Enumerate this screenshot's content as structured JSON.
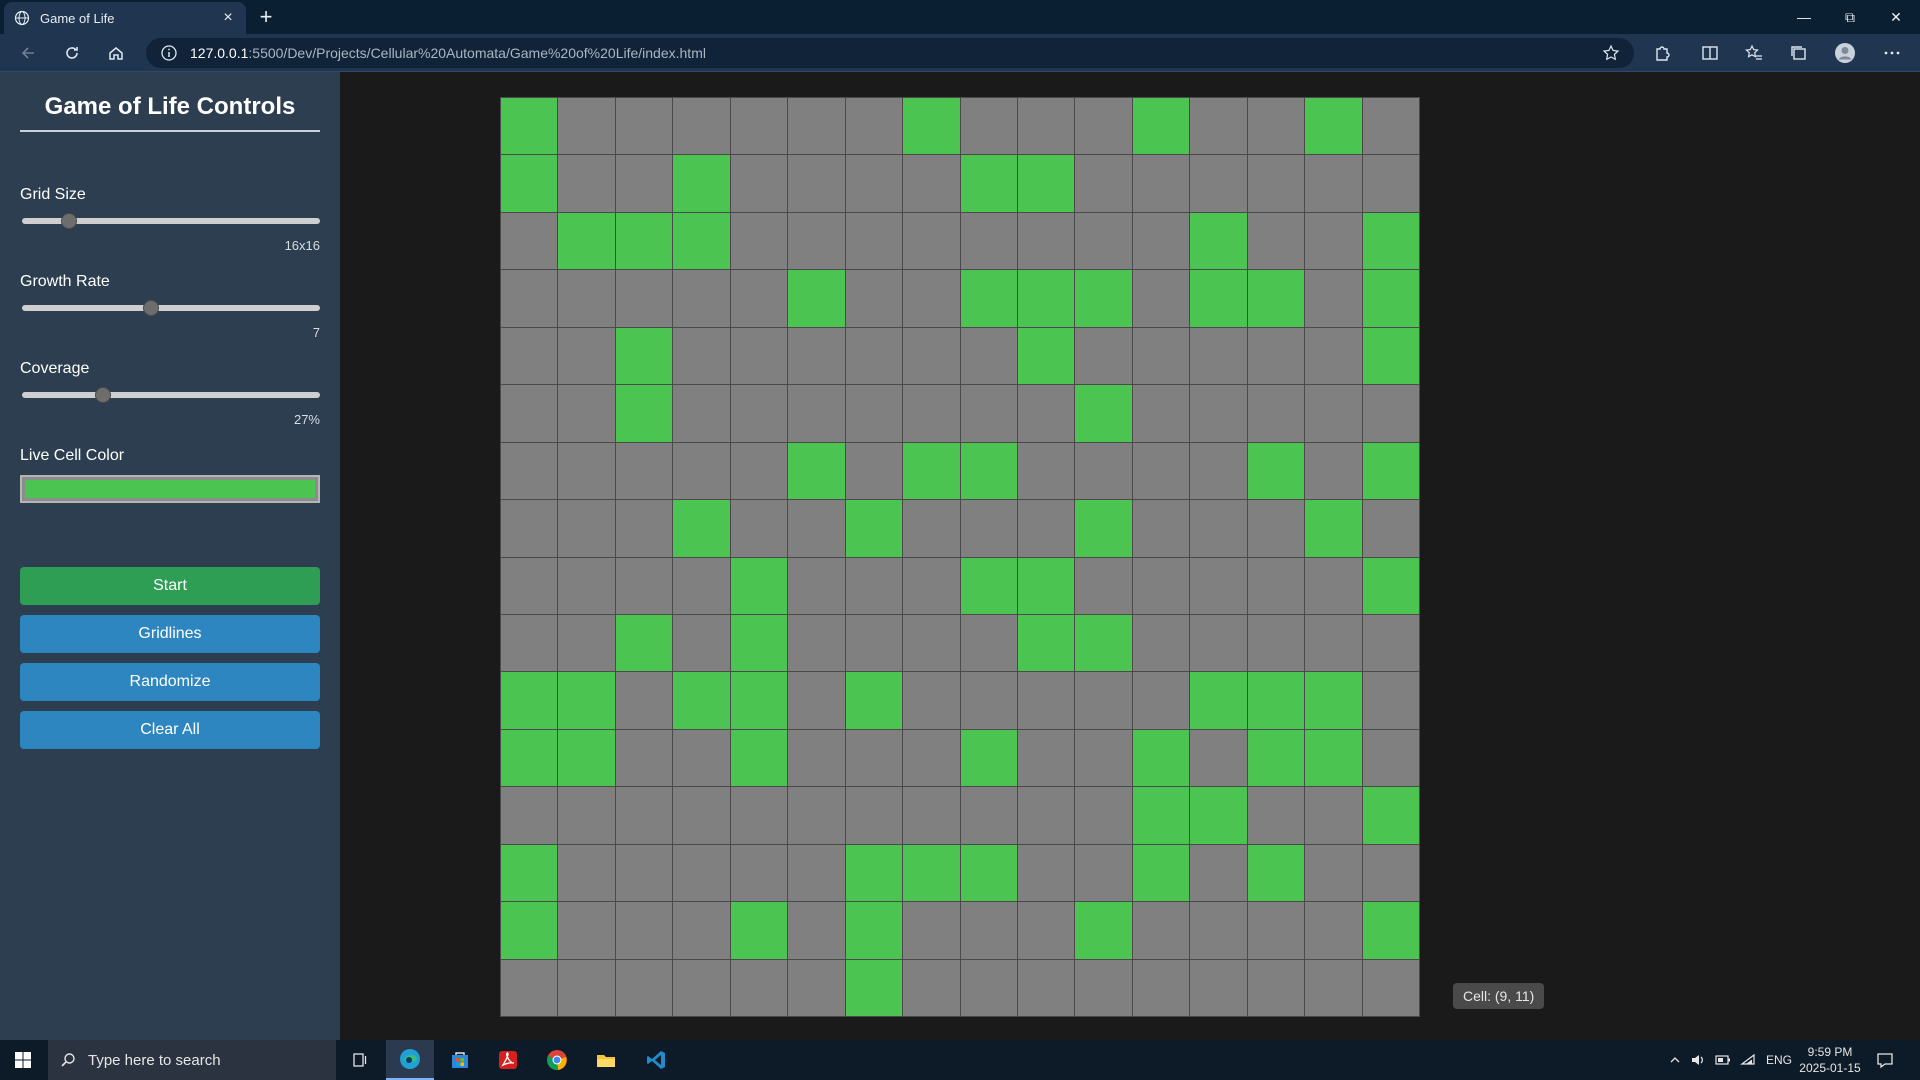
{
  "browser": {
    "tab_title": "Game of Life",
    "url_host": "127.0.0.1",
    "url_path": ":5500/Dev/Projects/Cellular%20Automata/Game%20of%20Life/index.html"
  },
  "sidebar": {
    "title": "Game of Life Controls",
    "grid_size": {
      "label": "Grid Size",
      "value_text": "16x16",
      "fraction": 0.14
    },
    "growth_rate": {
      "label": "Growth Rate",
      "value_text": "7",
      "fraction": 0.43
    },
    "coverage": {
      "label": "Coverage",
      "value_text": "27%",
      "fraction": 0.26
    },
    "live_cell_color": {
      "label": "Live Cell Color",
      "value": "#4cc452"
    },
    "buttons": {
      "start": "Start",
      "gridlines": "Gridlines",
      "randomize": "Randomize",
      "clear_all": "Clear All"
    }
  },
  "grid": {
    "size": 16,
    "alive_color": "#4cc452",
    "dead_color": "#808080",
    "rows": [
      "1000000100010010",
      "1001000011000000",
      "0111000000001001",
      "0000010011101101",
      "0010000001000001",
      "0010000000100000",
      "0000010110000101",
      "0001001000100010",
      "0000100011000001",
      "0010100001100000",
      "1101101000001110",
      "1100100010010110",
      "0000000000011001",
      "1000001110010100",
      "1000101000100001",
      "0000001000000000"
    ]
  },
  "tooltip": {
    "text": "Cell: (9, 11)"
  },
  "taskbar": {
    "search_placeholder": "Type here to search",
    "language": "ENG",
    "time": "9:59 PM",
    "date": "2025-01-15"
  }
}
